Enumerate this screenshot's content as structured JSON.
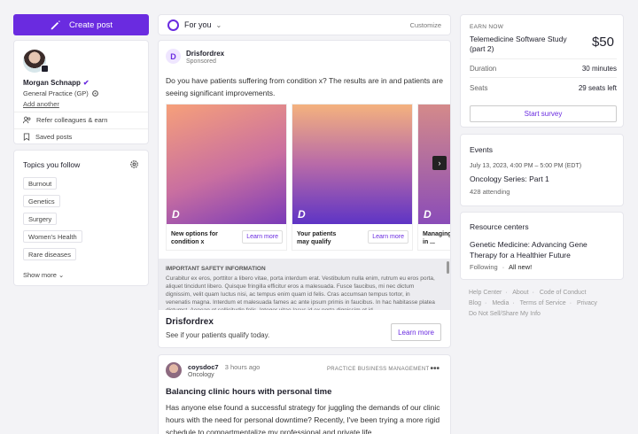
{
  "left": {
    "create_post": "Create post",
    "profile": {
      "name": "Morgan Schnapp",
      "specialty": "General Practice (GP)",
      "add_another": "Add another",
      "refer": "Refer colleagues & earn",
      "saved": "Saved posts"
    },
    "topics": {
      "title": "Topics you follow",
      "items": [
        "Burnout",
        "Genetics",
        "Surgery",
        "Women's Health",
        "Rare diseases"
      ],
      "show_more": "Show more"
    }
  },
  "feed": {
    "label": "For you",
    "customize": "Customize"
  },
  "ad": {
    "logo_letter": "D",
    "brand": "Drisfordrex",
    "sponsored": "Sponsored",
    "text": "Do you have patients suffering from condition x? The results are in and patients are seeing significant improvements.",
    "carousel": [
      {
        "caption_line1": "New options for",
        "caption_line2": "condition x",
        "cta": "Learn more"
      },
      {
        "caption_line1": "Your patients",
        "caption_line2": "may qualify",
        "cta": "Learn more"
      },
      {
        "caption_line1": "Managing",
        "caption_line2": "in ...",
        "cta": "Learn more"
      }
    ],
    "safety_title": "IMPORTANT SAFETY INFORMATION",
    "safety_body": "Curabitur ex eros, porttitor a libero vitae, porta interdum erat. Vestibulum nulla enim, rutrum eu eros porta, aliquet tincidunt libero. Quisque fringilla efficitur eros a malesuada. Fusce faucibus, mi nec dictum dignissim, velit quam luctus nisi, ac tempus enim quam id felis. Cras accumsan tempus tortor, in venenatis magna. Interdum et malesuada fames ac ante ipsum primis in faucibus. In hac habitasse platea dictumst. Aenean et sollicitudin felis. Integer vitae lacus id ex porta dignissim et id",
    "footer_name": "Drisfordrex",
    "footer_sub": "See if your patients qualify today.",
    "footer_cta": "Learn more"
  },
  "post": {
    "author": "coysdoc7",
    "time": "3 hours ago",
    "specialty": "Oncology",
    "category": "PRACTICE BUSINESS MANAGEMENT",
    "more": "•••",
    "title": "Balancing clinic hours with personal time",
    "body": "Has anyone else found a successful strategy for juggling the demands of our clinic hours with the need for personal downtime? Recently, I've been trying a more rigid schedule to compartmentalize my professional and private life."
  },
  "right": {
    "earn": {
      "label": "EARN NOW",
      "title": "Telemedicine Software Study (part 2)",
      "price": "$50",
      "duration_key": "Duration",
      "duration_val": "30 minutes",
      "seats_key": "Seats",
      "seats_val": "29 seats left",
      "cta": "Start survey"
    },
    "events": {
      "title": "Events",
      "date": "July 13, 2023, 4:00 PM – 5:00 PM (EDT)",
      "name": "Oncology Series: Part 1",
      "attending": "428 attending"
    },
    "resources": {
      "title": "Resource centers",
      "name": "Genetic Medicine: Advancing Gene Therapy for a Healthier Future",
      "following": "Following",
      "new": "All new!"
    },
    "footer_links": [
      "Help Center",
      "About",
      "Code of Conduct",
      "Blog",
      "Media",
      "Terms of Service",
      "Privacy",
      "Do Not Sell/Share My Info"
    ]
  }
}
